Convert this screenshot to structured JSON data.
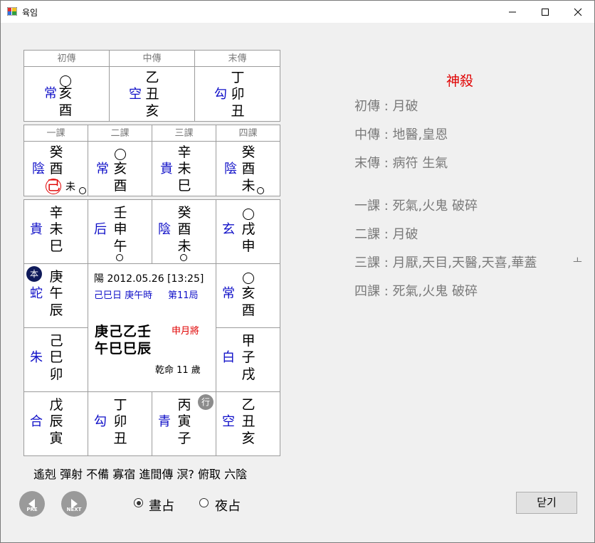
{
  "window": {
    "title": "육임"
  },
  "chuan": {
    "headers": [
      "初傳",
      "中傳",
      "末傳"
    ],
    "cols": [
      {
        "top": "",
        "god": "常",
        "mid": "亥",
        "bot": "酉"
      },
      {
        "top": "乙",
        "god": "空",
        "mid": "丑",
        "bot": "亥"
      },
      {
        "top": "丁",
        "god": "勾",
        "mid": "卯",
        "bot": "丑"
      }
    ]
  },
  "ke": {
    "headers": [
      "一課",
      "二課",
      "三課",
      "四課"
    ],
    "cols": [
      {
        "top": "癸",
        "god": "陰",
        "mid": "酉",
        "bot": "己",
        "extra": "未"
      },
      {
        "top": "",
        "god": "常",
        "mid": "亥",
        "bot": "酉"
      },
      {
        "top": "辛",
        "god": "貴",
        "mid": "未",
        "bot": "巳"
      },
      {
        "top": "癸",
        "god": "陰",
        "mid": "酉",
        "bot": "未"
      }
    ]
  },
  "palace": {
    "top": [
      {
        "top": "辛",
        "god": "貴",
        "mid": "未",
        "bot": "巳"
      },
      {
        "top": "壬",
        "god": "后",
        "mid": "申",
        "bot": "午"
      },
      {
        "top": "癸",
        "god": "陰",
        "mid": "酉",
        "bot": "未"
      },
      {
        "top": "",
        "god": "玄",
        "mid": "戌",
        "bot": "申"
      }
    ],
    "left1": {
      "top": "庚",
      "god": "蛇",
      "mid": "午",
      "bot": "辰",
      "badge": "本"
    },
    "left2": {
      "top": "己",
      "god": "朱",
      "mid": "巳",
      "bot": "卯"
    },
    "right1": {
      "top": "",
      "god": "常",
      "mid": "亥",
      "bot": "酉"
    },
    "right2": {
      "top": "甲",
      "god": "白",
      "mid": "子",
      "bot": "戌"
    },
    "bottom": [
      {
        "top": "戊",
        "god": "合",
        "mid": "辰",
        "bot": "寅"
      },
      {
        "top": "丁",
        "god": "勾",
        "mid": "卯",
        "bot": "丑"
      },
      {
        "top": "丙",
        "god": "青",
        "mid": "寅",
        "bot": "子",
        "badge": "行"
      },
      {
        "top": "乙",
        "god": "空",
        "mid": "丑",
        "bot": "亥"
      }
    ]
  },
  "center": {
    "date_line": "陽 2012.05.26 [13:25]",
    "day_pillar": "己巳日 庚午時",
    "ju": "第11局",
    "stems": "庚己乙壬",
    "branches": "午巳巳辰",
    "general": "申月將",
    "age": "乾命 11 歲"
  },
  "patterns": "遙剋 彈射 不備 寡宿 進間傳 溟? 俯取 六陰",
  "shensha": {
    "title": "神殺",
    "rows": [
      "初傳 :  月破",
      "中傳 :  地醫,皇恩",
      "末傳 : 病符 生氣",
      "一課 :  死氣,火鬼 破碎",
      "二課 :  月破",
      "三課 :  月厭,天目,天醫,天喜,華蓋",
      "四課 :  死氣,火鬼 破碎"
    ],
    "overflow_mark": "ㅗ"
  },
  "controls": {
    "prev_label": "PRE",
    "next_label": "NEXT",
    "radio_day": "晝占",
    "radio_night": "夜占",
    "selected": "晝占",
    "close_label": "닫기"
  },
  "colors": {
    "god": "#1010c8",
    "accent_red": "#e00000",
    "label_gray": "#7a7a7a",
    "badge_navy": "#0f1a5a",
    "badge_gray": "#8c8c8c"
  }
}
